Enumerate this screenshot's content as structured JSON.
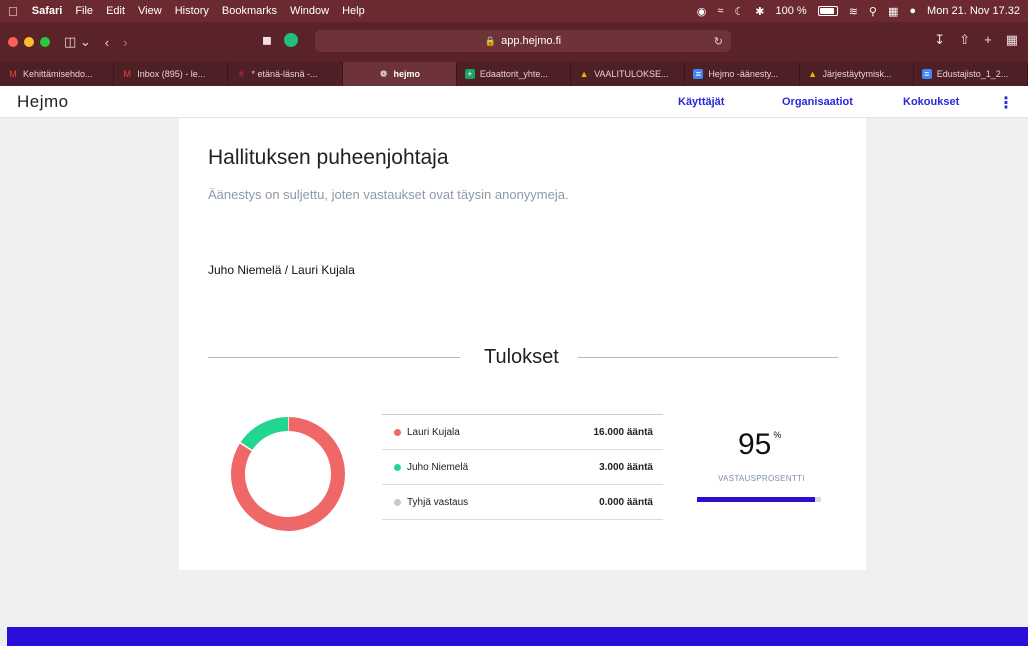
{
  "menubar": {
    "app": "Safari",
    "items": [
      "File",
      "Edit",
      "View",
      "History",
      "Bookmarks",
      "Window",
      "Help"
    ],
    "battery": "100 %",
    "datetime": "Mon 21. Nov 17.32"
  },
  "browser": {
    "url": "app.hejmo.fi",
    "tabs": [
      {
        "label": "Kehittämisehdo...",
        "icon": "gmail-icon",
        "color": "#e8453c"
      },
      {
        "label": "Inbox (895) - le...",
        "icon": "gmail-icon",
        "color": "#e8453c"
      },
      {
        "label": "* etänä-läsnä -...",
        "icon": "slack-icon",
        "color": "#e01e5a"
      },
      {
        "label": "hejmo",
        "icon": "hejmo-icon",
        "color": "#ffffff",
        "active": true
      },
      {
        "label": "Edaattorit_yhte...",
        "icon": "sheets-icon",
        "color": "#1ea362"
      },
      {
        "label": "VAALITULOKSE...",
        "icon": "drive-icon",
        "color": "#f4b400"
      },
      {
        "label": "Hejmo -äänesty...",
        "icon": "docs-icon",
        "color": "#4285f4"
      },
      {
        "label": "Järjestäytymisk...",
        "icon": "drive-icon",
        "color": "#f4b400"
      },
      {
        "label": "Edustajisto_1_2...",
        "icon": "docs-icon",
        "color": "#4285f4"
      }
    ]
  },
  "app": {
    "brand": "Hejmo",
    "nav": {
      "users": "Käyttäjät",
      "organizations": "Organisaatiot",
      "meetings": "Kokoukset"
    },
    "accent": "#2a28d8"
  },
  "poll": {
    "title": "Hallituksen puheenjohtaja",
    "subtitle": "Äänestys on suljettu, joten vastaukset ovat täysin anonyymeja.",
    "option": "Juho Niemelä / Lauri Kujala",
    "results_heading": "Tulokset",
    "results": [
      {
        "name": "Lauri Kujala",
        "votes": 16,
        "votes_label": "16.000 ääntä",
        "color": "#f06767"
      },
      {
        "name": "Juho Niemelä",
        "votes": 3,
        "votes_label": "3.000 ääntä",
        "color": "#22d692"
      },
      {
        "name": "Tyhjä vastaus",
        "votes": 0,
        "votes_label": "0.000 ääntä",
        "color": "#c3cad3"
      }
    ],
    "turnout": {
      "value": "95",
      "unit": "%",
      "label": "VASTAUSPROSENTTI",
      "fraction": 0.95,
      "color": "#2a0fcf"
    }
  }
}
